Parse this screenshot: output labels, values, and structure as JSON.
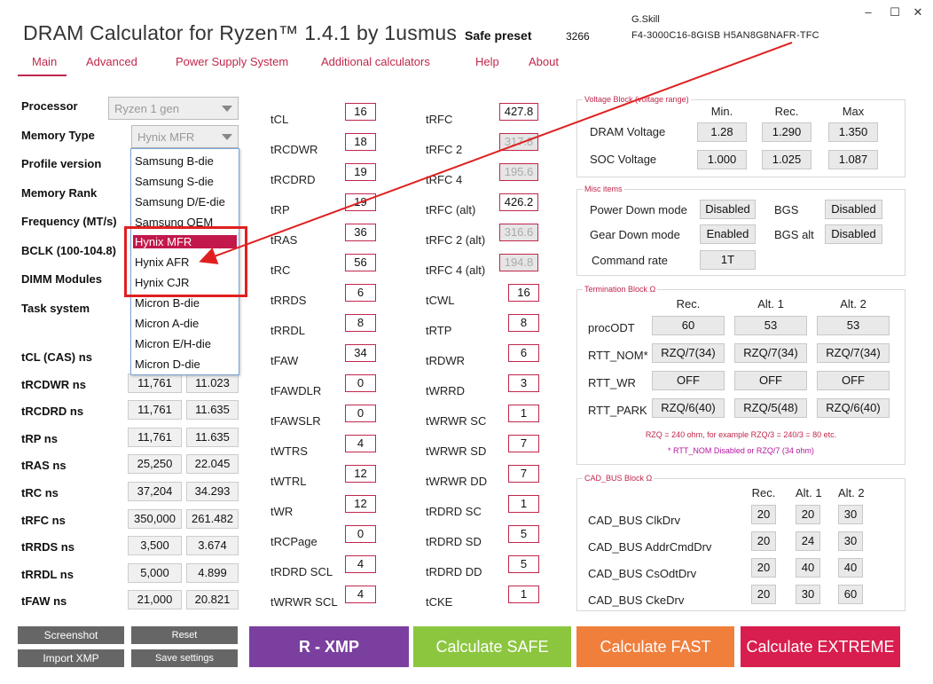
{
  "header": {
    "title": "DRAM Calculator for Ryzen™ 1.4.1 by 1usmus",
    "preset_label": "Safe preset",
    "preset_value": "3266",
    "kit_line1": "G.Skill",
    "kit_line2": "F4-3000C16-8GISB   H5AN8G8NAFR-TFC",
    "win_min": "–",
    "win_max": "☐",
    "win_close": "✕"
  },
  "menu": [
    "Main",
    "Advanced",
    "Power Supply System",
    "Additional calculators",
    "Help",
    "About"
  ],
  "left": {
    "processor_label": "Processor",
    "processor_value": "Ryzen 1 gen",
    "memtype_label": "Memory Type",
    "memtype_value": "Hynix MFR",
    "profile_label": "Profile version",
    "rank_label": "Memory Rank",
    "freq_label": "Frequency (MT/s)",
    "bclk_label": "BCLK (100-104.8)",
    "dimm_label": "DIMM Modules",
    "task_label": "Task system"
  },
  "dropdown": [
    "Samsung B-die",
    "Samsung S-die",
    "Samsung D/E-die",
    "Samsung OEM",
    "Hynix MFR",
    "Hynix AFR",
    "Hynix CJR",
    "Micron B-die",
    "Micron A-die",
    "Micron E/H-die",
    "Micron D-die"
  ],
  "ns_rows": [
    {
      "label": "tCL (CAS) ns",
      "a": "",
      "b": ""
    },
    {
      "label": "tRCDWR ns",
      "a": "11,761",
      "b": "11.023"
    },
    {
      "label": "tRCDRD ns",
      "a": "11,761",
      "b": "11.635"
    },
    {
      "label": "tRP ns",
      "a": "11,761",
      "b": "11.635"
    },
    {
      "label": "tRAS ns",
      "a": "25,250",
      "b": "22.045"
    },
    {
      "label": "tRC ns",
      "a": "37,204",
      "b": "34.293"
    },
    {
      "label": "tRFC ns",
      "a": "350,000",
      "b": "261.482"
    },
    {
      "label": "tRRDS ns",
      "a": "3,500",
      "b": "3.674"
    },
    {
      "label": "tRRDL ns",
      "a": "5,000",
      "b": "4.899"
    },
    {
      "label": "tFAW ns",
      "a": "21,000",
      "b": "20.821"
    }
  ],
  "timings1": [
    {
      "label": "tCL",
      "value": "16"
    },
    {
      "label": "tRCDWR",
      "value": "18"
    },
    {
      "label": "tRCDRD",
      "value": "19"
    },
    {
      "label": "tRP",
      "value": "19"
    },
    {
      "label": "tRAS",
      "value": "36"
    },
    {
      "label": "tRC",
      "value": "56"
    },
    {
      "label": "tRRDS",
      "value": "6"
    },
    {
      "label": "tRRDL",
      "value": "8"
    },
    {
      "label": "tFAW",
      "value": "34"
    },
    {
      "label": "tFAWDLR",
      "value": "0"
    },
    {
      "label": "tFAWSLR",
      "value": "0"
    },
    {
      "label": "tWTRS",
      "value": "4"
    },
    {
      "label": "tWTRL",
      "value": "12"
    },
    {
      "label": "tWR",
      "value": "12"
    },
    {
      "label": "tRCPage",
      "value": "0"
    },
    {
      "label": "tRDRD SCL",
      "value": "4"
    },
    {
      "label": "tWRWR SCL",
      "value": "4"
    }
  ],
  "timings2": [
    {
      "label": "tRFC",
      "value": "427.8"
    },
    {
      "label": "tRFC 2",
      "value": "317.8"
    },
    {
      "label": "tRFC 4",
      "value": "195.6"
    },
    {
      "label": "tRFC (alt)",
      "value": "426.2"
    },
    {
      "label": "tRFC 2 (alt)",
      "value": "316.6"
    },
    {
      "label": "tRFC 4 (alt)",
      "value": "194.8"
    },
    {
      "label": "tCWL",
      "value": "16"
    },
    {
      "label": "tRTP",
      "value": "8"
    },
    {
      "label": "tRDWR",
      "value": "6"
    },
    {
      "label": "tWRRD",
      "value": "3"
    },
    {
      "label": "tWRWR SC",
      "value": "1"
    },
    {
      "label": "tWRWR SD",
      "value": "7"
    },
    {
      "label": "tWRWR DD",
      "value": "7"
    },
    {
      "label": "tRDRD SC",
      "value": "1"
    },
    {
      "label": "tRDRD SD",
      "value": "5"
    },
    {
      "label": "tRDRD DD",
      "value": "5"
    },
    {
      "label": "tCKE",
      "value": "1"
    }
  ],
  "voltage": {
    "title": "Voltage Block (voltage range)",
    "cols": [
      "Min.",
      "Rec.",
      "Max"
    ],
    "rows": [
      {
        "label": "DRAM Voltage",
        "v": [
          "1.28",
          "1.290",
          "1.350"
        ]
      },
      {
        "label": "SOC Voltage",
        "v": [
          "1.000",
          "1.025",
          "1.087"
        ]
      }
    ]
  },
  "misc": {
    "title": "Misc items",
    "power_down_label": "Power Down mode",
    "power_down": "Disabled",
    "bgs_label": "BGS",
    "bgs": "Disabled",
    "gear_down_label": "Gear Down mode",
    "gear_down": "Enabled",
    "bgs_alt_label": "BGS alt",
    "bgs_alt": "Disabled",
    "cmd_rate_label": "Command rate",
    "cmd_rate": "1T"
  },
  "termination": {
    "title": "Termination Block Ω",
    "cols": [
      "Rec.",
      "Alt. 1",
      "Alt. 2"
    ],
    "rows": [
      {
        "label": "procODT",
        "v": [
          "60",
          "53",
          "53"
        ]
      },
      {
        "label": "RTT_NOM*",
        "v": [
          "RZQ/7(34)",
          "RZQ/7(34)",
          "RZQ/7(34)"
        ]
      },
      {
        "label": "RTT_WR",
        "v": [
          "OFF",
          "OFF",
          "OFF"
        ]
      },
      {
        "label": "RTT_PARK",
        "v": [
          "RZQ/6(40)",
          "RZQ/5(48)",
          "RZQ/6(40)"
        ]
      }
    ],
    "note1": "RZQ = 240 ohm, for example RZQ/3 = 240/3 = 80 etc.",
    "note2": "* RTT_NOM Disabled or RZQ/7 (34 ohm)"
  },
  "cadbus": {
    "title": "CAD_BUS Block Ω",
    "cols": [
      "Rec.",
      "Alt. 1",
      "Alt. 2"
    ],
    "rows": [
      {
        "label": "CAD_BUS ClkDrv",
        "v": [
          "20",
          "20",
          "30"
        ]
      },
      {
        "label": "CAD_BUS AddrCmdDrv",
        "v": [
          "20",
          "24",
          "30"
        ]
      },
      {
        "label": "CAD_BUS CsOdtDrv",
        "v": [
          "20",
          "40",
          "40"
        ]
      },
      {
        "label": "CAD_BUS CkeDrv",
        "v": [
          "20",
          "30",
          "60"
        ]
      }
    ]
  },
  "buttons": {
    "screenshot": "Screenshot",
    "reset": "Reset",
    "import_xmp": "Import XMP",
    "save_settings": "Save settings",
    "rxmp": "R - XMP",
    "safe": "Calculate SAFE",
    "fast": "Calculate FAST",
    "extreme": "Calculate EXTREME"
  },
  "colors": {
    "accent": "#c0274b",
    "rxmp": "#7b3fa0",
    "safe": "#8cc63f",
    "fast": "#f07f3c",
    "extreme": "#d81e4e",
    "annotation": "#e02020"
  }
}
